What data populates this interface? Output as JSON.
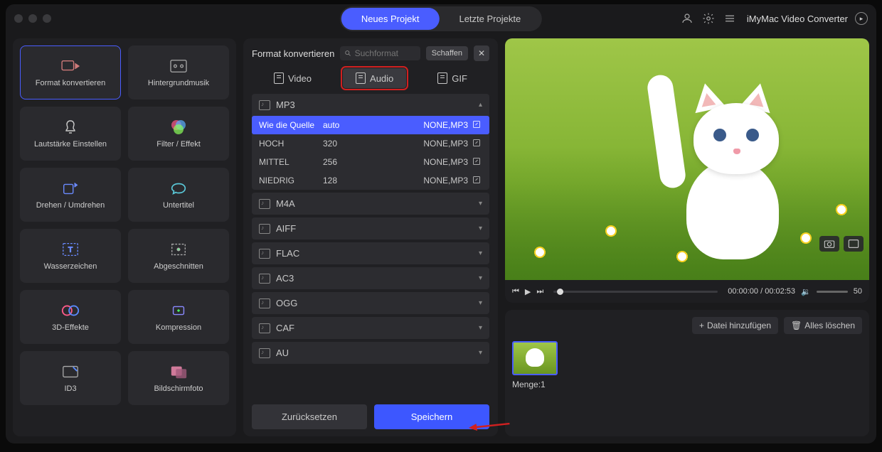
{
  "header": {
    "tabs": [
      "Neues Projekt",
      "Letzte Projekte"
    ],
    "active_tab": 0,
    "app_name": "iMyMac Video Converter"
  },
  "sidebar": {
    "tools": [
      {
        "label": "Format konvertieren",
        "icon": "convert",
        "selected": true
      },
      {
        "label": "Hintergrundmusik",
        "icon": "music"
      },
      {
        "label": "Lautstärke Einstellen",
        "icon": "volume"
      },
      {
        "label": "Filter / Effekt",
        "icon": "filter"
      },
      {
        "label": "Drehen / Umdrehen",
        "icon": "rotate"
      },
      {
        "label": "Untertitel",
        "icon": "subtitle"
      },
      {
        "label": "Wasserzeichen",
        "icon": "watermark"
      },
      {
        "label": "Abgeschnitten",
        "icon": "crop"
      },
      {
        "label": "3D-Effekte",
        "icon": "3d"
      },
      {
        "label": "Kompression",
        "icon": "compress"
      },
      {
        "label": "ID3",
        "icon": "id3"
      },
      {
        "label": "Bildschirmfoto",
        "icon": "screenshot"
      }
    ]
  },
  "middle": {
    "title": "Format konvertieren",
    "search_placeholder": "Suchformat",
    "create_btn": "Schaffen",
    "format_tabs": [
      {
        "label": "Video",
        "active": false
      },
      {
        "label": "Audio",
        "active": true,
        "highlight": true
      },
      {
        "label": "GIF",
        "active": false
      }
    ],
    "expanded_format": "MP3",
    "qualities": [
      {
        "name": "Wie die Quelle",
        "bitrate": "auto",
        "codec": "NONE,MP3",
        "selected": true
      },
      {
        "name": "HOCH",
        "bitrate": "320",
        "codec": "NONE,MP3"
      },
      {
        "name": "MITTEL",
        "bitrate": "256",
        "codec": "NONE,MP3"
      },
      {
        "name": "NIEDRIG",
        "bitrate": "128",
        "codec": "NONE,MP3"
      }
    ],
    "other_formats": [
      "M4A",
      "AIFF",
      "FLAC",
      "AC3",
      "OGG",
      "CAF",
      "AU"
    ],
    "reset_btn": "Zurücksetzen",
    "save_btn": "Speichern"
  },
  "preview": {
    "current_time": "00:00:00",
    "total_time": "00:02:53",
    "volume": "50"
  },
  "bottom": {
    "add_file": "Datei hinzufügen",
    "clear_all": "Alles löschen",
    "count_label": "Menge:",
    "count_value": "1"
  }
}
